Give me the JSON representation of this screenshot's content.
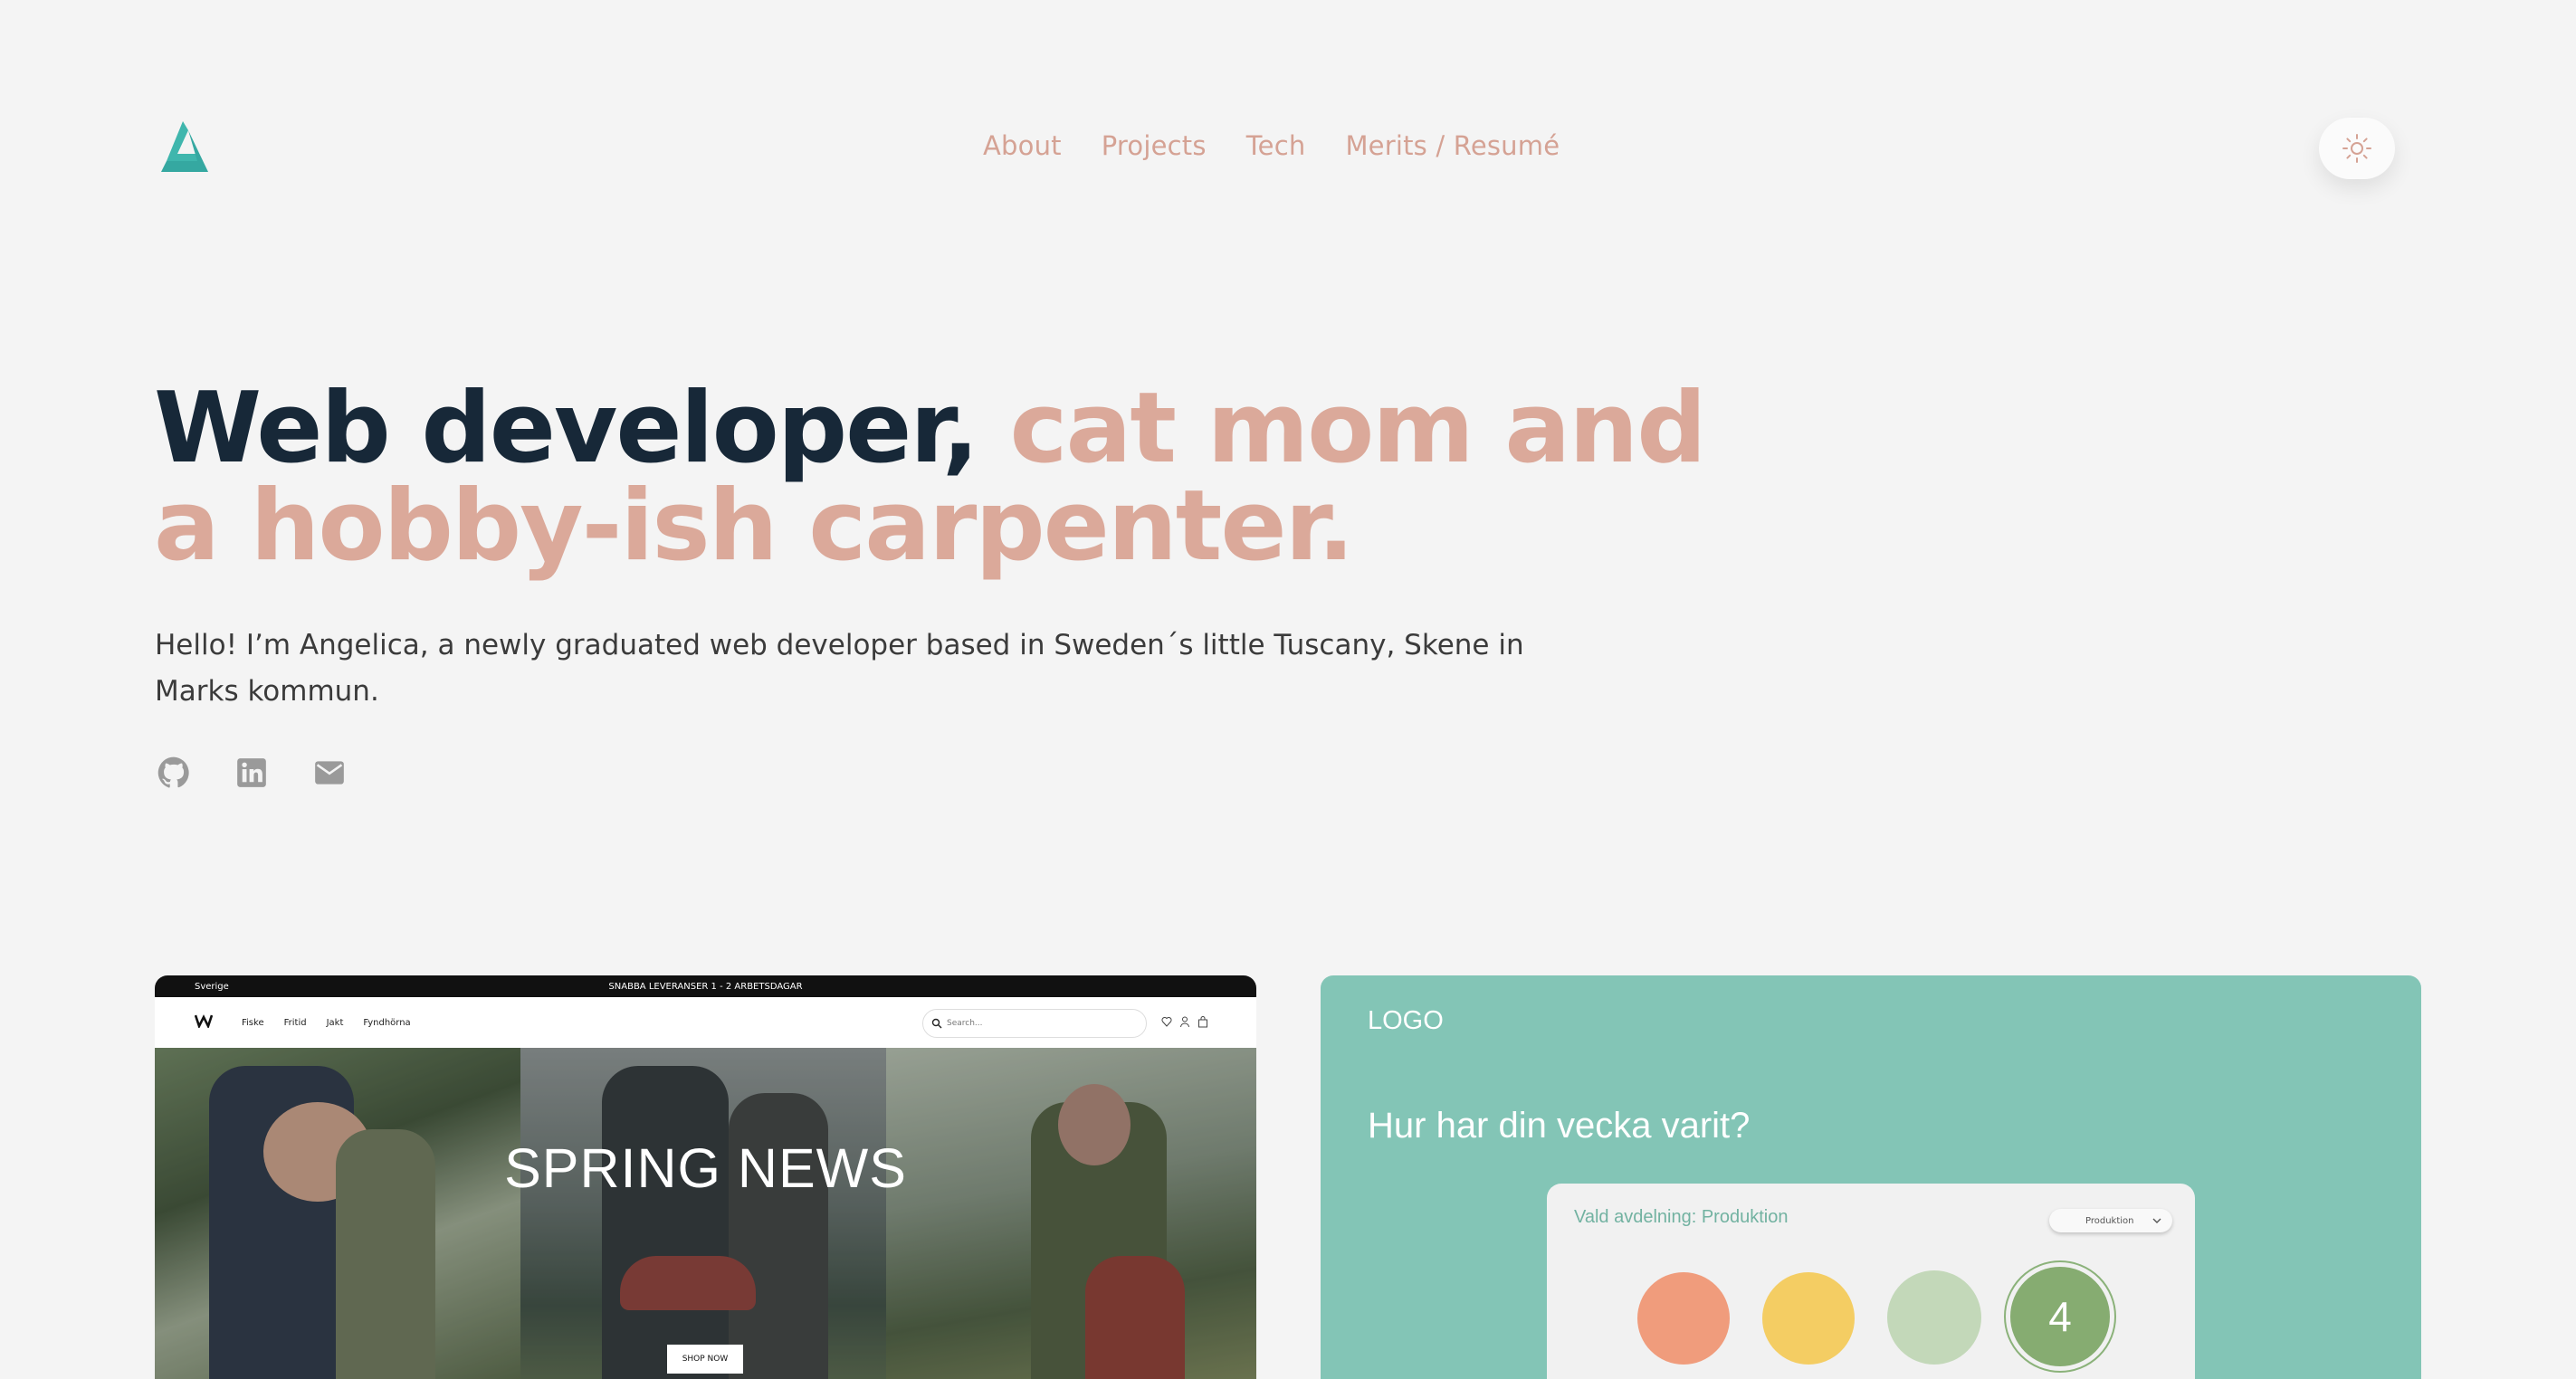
{
  "header": {
    "logo_icon": "triangle-logo-icon",
    "nav": [
      "About",
      "Projects",
      "Tech",
      "Merits / Resumé"
    ],
    "theme_toggle_icon": "sun-icon"
  },
  "hero": {
    "title_dark": "Web developer, ",
    "title_accent": "cat mom and a hobby-ish carpenter.",
    "intro": "Hello! I’m Angelica, a newly graduated web developer based in Sweden´s little Tuscany, Skene in Marks kommun.",
    "socials": [
      "github-icon",
      "linkedin-icon",
      "mail-icon"
    ]
  },
  "projects": {
    "shop": {
      "country": "Sverige",
      "promo": "SNABBA LEVERANSER 1 - 2 ARBETSDAGAR",
      "nav_links": [
        "Fiske",
        "Fritid",
        "Jakt",
        "Fyndhörna"
      ],
      "search_placeholder": "Search...",
      "headline": "SPRING NEWS",
      "cta": "SHOP NOW"
    },
    "survey": {
      "logo": "LOGO",
      "question": "Hur har din vecka varit?",
      "department": "Vald avdelning: Produktion",
      "select_value": "Produktion",
      "selected_rating": "4"
    }
  },
  "colors": {
    "accent": "#dba99a",
    "dark": "#172838",
    "teal": "#3fb6ad",
    "survey_bg": "#83c5b6"
  }
}
